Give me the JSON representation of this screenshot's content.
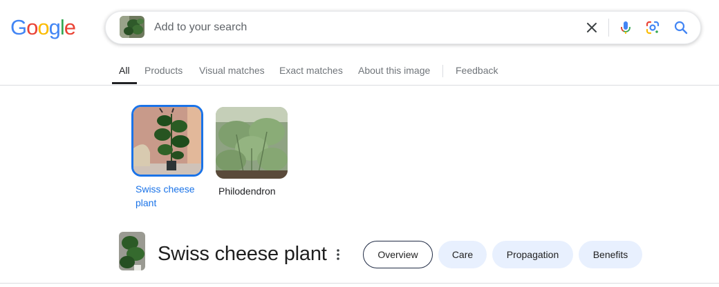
{
  "logo": {
    "letters": [
      "G",
      "o",
      "o",
      "g",
      "l",
      "e"
    ],
    "colors": [
      "#4285F4",
      "#EA4335",
      "#FBBC05",
      "#4285F4",
      "#34A853",
      "#EA4335"
    ]
  },
  "search": {
    "placeholder": "Add to your search",
    "value": ""
  },
  "tabs": [
    {
      "label": "All",
      "active": true
    },
    {
      "label": "Products"
    },
    {
      "label": "Visual matches"
    },
    {
      "label": "Exact matches"
    },
    {
      "label": "About this image"
    },
    {
      "label": "Feedback"
    }
  ],
  "matches": [
    {
      "label": "Swiss cheese plant",
      "selected": true
    },
    {
      "label": "Philodendron",
      "selected": false
    }
  ],
  "entity": {
    "title": "Swiss cheese plant",
    "chips": [
      {
        "label": "Overview",
        "active": true
      },
      {
        "label": "Care"
      },
      {
        "label": "Propagation"
      },
      {
        "label": "Benefits"
      }
    ]
  },
  "colors": {
    "accent": "#1a73e8",
    "chip_bg": "#e8f0fe",
    "tab_text": "#70757a"
  },
  "icons": [
    "clear-icon",
    "microphone-icon",
    "google-lens-icon",
    "search-icon",
    "more-vert-icon"
  ]
}
